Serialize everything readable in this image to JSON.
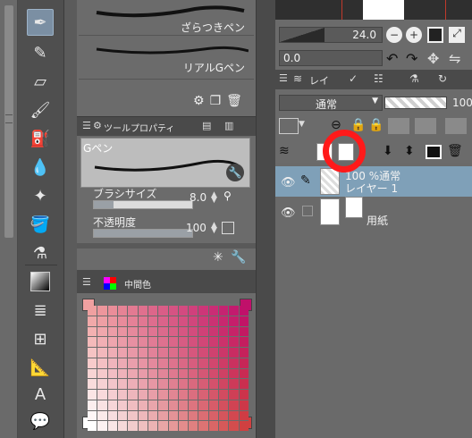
{
  "brush_panel": {
    "items": [
      "ざらつきペン",
      "リアルGペン"
    ]
  },
  "tool_property": {
    "tab_title": "ツールプロパティ",
    "brush_name": "Gペン",
    "brush_size_label": "ブラシサイズ",
    "brush_size_value": "8.0",
    "opacity_label": "不透明度",
    "opacity_value": "100"
  },
  "color_panel": {
    "tab_title": "中間色",
    "corner_colors": {
      "top_left": "#f0a0a0",
      "top_right": "#c0106a",
      "bottom_left": "#ffffff",
      "bottom_right": "#d04040"
    }
  },
  "navigator": {
    "zoom": "24.0",
    "angle": "0.0"
  },
  "layer_panel": {
    "tab_label": "レイ",
    "blend_mode": "通常",
    "opacity": "100",
    "layers": [
      {
        "name_line1": "100 %通常",
        "name_line2": "レイヤー 1",
        "selected": true
      },
      {
        "name_line1": "用紙",
        "name_line2": "",
        "selected": false
      }
    ]
  },
  "accent": {
    "selection": "#7fa0b8",
    "highlight_ring": "#ff1a1a"
  }
}
